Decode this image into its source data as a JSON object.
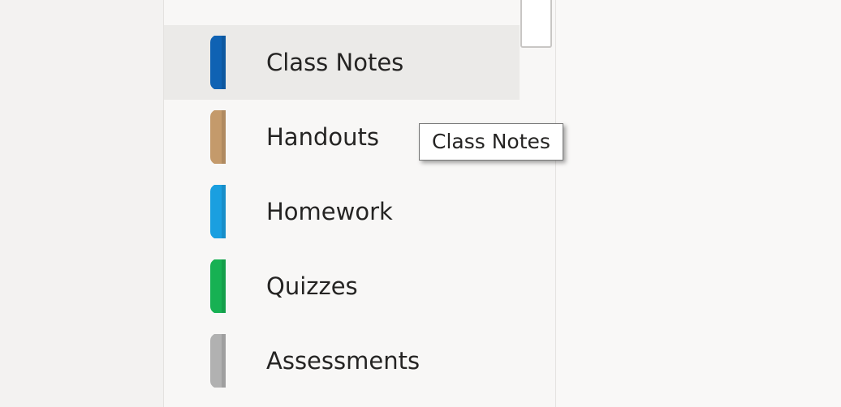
{
  "sections": [
    {
      "label": "Class Notes",
      "tab_color": "#0f62b3",
      "selected": true
    },
    {
      "label": "Handouts",
      "tab_color": "#c49a6b",
      "selected": false
    },
    {
      "label": "Homework",
      "tab_color": "#1a9fe0",
      "selected": false
    },
    {
      "label": "Quizzes",
      "tab_color": "#17b153",
      "selected": false
    },
    {
      "label": "Assessments",
      "tab_color": "#b1b1b1",
      "selected": false
    }
  ],
  "tooltip": {
    "text": "Class Notes"
  }
}
